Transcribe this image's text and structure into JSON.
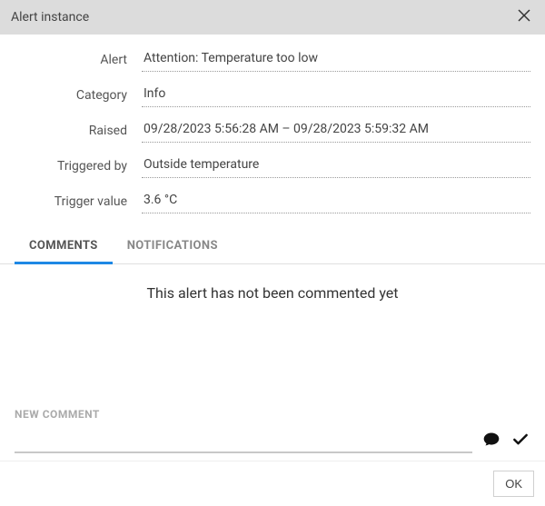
{
  "dialog": {
    "title": "Alert instance"
  },
  "fields": {
    "alert_label": "Alert",
    "alert_value": "Attention: Temperature too low",
    "category_label": "Category",
    "category_value": "Info",
    "raised_label": "Raised",
    "raised_value": "09/28/2023 5:56:28 AM – 09/28/2023 5:59:32 AM",
    "triggered_by_label": "Triggered by",
    "triggered_by_value": "Outside temperature",
    "trigger_value_label": "Trigger value",
    "trigger_value_value": "3.6 °C"
  },
  "tabs": {
    "comments": "COMMENTS",
    "notifications": "NOTIFICATIONS"
  },
  "comments_panel": {
    "empty_message": "This alert has not been commented yet",
    "new_comment_label": "NEW COMMENT"
  },
  "footer": {
    "ok": "OK"
  }
}
